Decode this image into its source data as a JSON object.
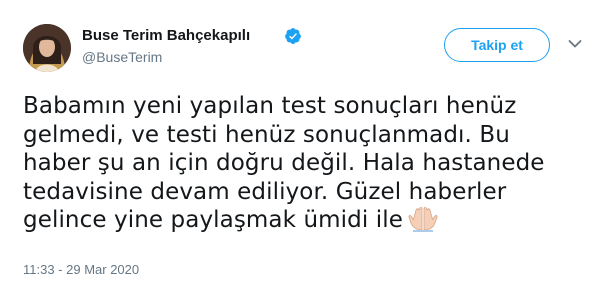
{
  "tweet": {
    "author": {
      "name": "Buse Terim Bahçekapılı",
      "handle": "@BuseTerim",
      "verified": true
    },
    "follow_label": "Takip et",
    "text_lines": [
      "Babamın yeni yapılan test sonuçları henüz",
      "gelmedi, ve testi henüz sonuçlanmadı. Bu",
      "haber şu an için doğru değil. Hala hastanede",
      "tedavisine devam ediliyor. Güzel haberler",
      "gelince yine paylaşmak ümidi ile"
    ],
    "emoji": "folded-hands",
    "timestamp": "11:33 - 29 Mar 2020"
  },
  "colors": {
    "accent": "#1da1f2",
    "text_primary": "#14171a",
    "text_secondary": "#657786"
  }
}
